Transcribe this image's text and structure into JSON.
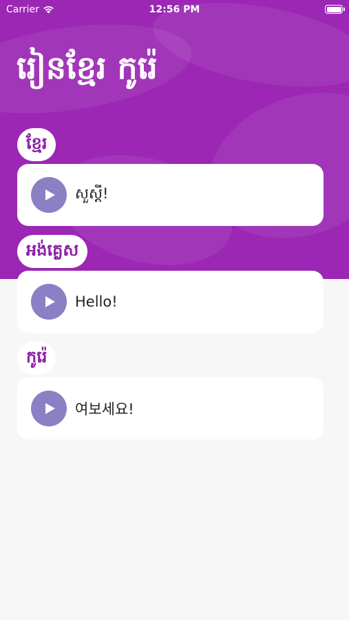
{
  "status_bar": {
    "carrier": "Carrier",
    "time": "12:56 PM"
  },
  "app": {
    "title": "រៀនខ្មែរ កូរ៉េ",
    "accent": "#9b27b4"
  },
  "sections": [
    {
      "language": "ខ្មែរ",
      "phrase": "សួស្តី!"
    },
    {
      "language": "អង់គ្លេស",
      "phrase": "Hello!"
    },
    {
      "language": "កូរ៉េ",
      "phrase": "여보세요!"
    }
  ]
}
